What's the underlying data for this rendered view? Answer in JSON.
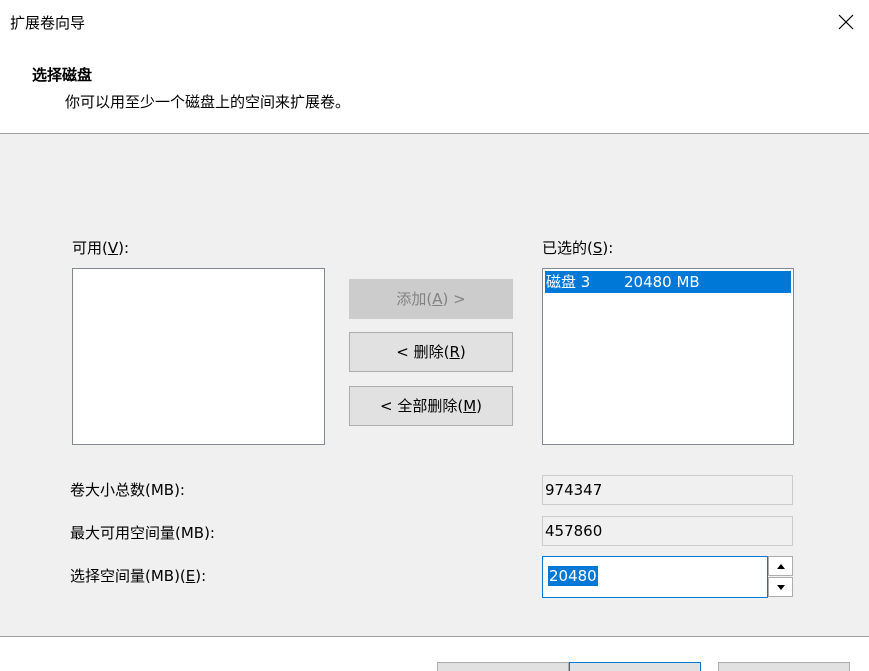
{
  "window": {
    "title": "扩展卷向导",
    "close_icon": "close-icon"
  },
  "header": {
    "title": "选择磁盘",
    "description": "你可以用至少一个磁盘上的空间来扩展卷。"
  },
  "available": {
    "label": "可用(",
    "hotkey": "V",
    "label_end": "):",
    "items": []
  },
  "selected": {
    "label": "已选的(",
    "hotkey": "S",
    "label_end": "):",
    "items": [
      {
        "disk": "磁盘 3",
        "size": "20480 MB",
        "selected": true
      }
    ]
  },
  "buttons": {
    "add": {
      "label": "添加(",
      "hotkey": "A",
      "label_end": ") >",
      "enabled": false
    },
    "remove": {
      "label": "< 删除(",
      "hotkey": "R",
      "label_end": ")",
      "enabled": true
    },
    "remove_all": {
      "label": "< 全部删除(",
      "hotkey": "M",
      "label_end": ")",
      "enabled": true
    }
  },
  "fields": {
    "total_size": {
      "label": "卷大小总数(MB):",
      "value": "974347"
    },
    "max_available": {
      "label": "最大可用空间量(MB):",
      "value": "457860"
    },
    "select_amount": {
      "label": "选择空间量(MB)(",
      "hotkey": "E",
      "label_end": "):",
      "value": "20480"
    }
  },
  "colors": {
    "selection": "#0078d7",
    "panel_bg": "#f0f0f0",
    "disabled_text": "#838383"
  }
}
